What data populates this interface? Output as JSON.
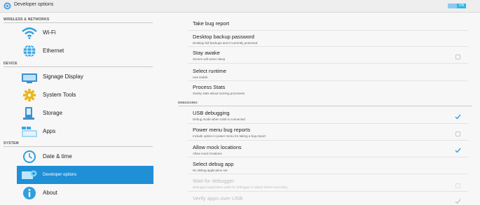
{
  "window": {
    "title": "Developer options",
    "toggle_label": "ON"
  },
  "sidebar": {
    "sections": [
      "WIRELESS & NETWORKS",
      "DEVICE",
      "SYSTEM"
    ],
    "items": [
      {
        "label": "Wi-Fi",
        "icon": "wifi-icon"
      },
      {
        "label": "Ethernet",
        "icon": "ethernet-icon"
      },
      {
        "label": "Signage Display",
        "icon": "display-icon"
      },
      {
        "label": "System Tools",
        "icon": "gear-icon"
      },
      {
        "label": "Storage",
        "icon": "storage-icon"
      },
      {
        "label": "Apps",
        "icon": "apps-icon"
      },
      {
        "label": "Date & time",
        "icon": "clock-icon"
      },
      {
        "label": "Developer options",
        "icon": "developer-icon"
      },
      {
        "label": "About",
        "icon": "info-icon"
      }
    ],
    "active_color": "#1f8fd6"
  },
  "content": {
    "debugging_header": "DEBUGGING",
    "rows": [
      {
        "title": "Take bug report",
        "summary": ""
      },
      {
        "title": "Desktop backup password",
        "summary": "Desktop full backups aren't currently protected"
      },
      {
        "title": "Stay awake",
        "summary": "Screen will never sleep"
      },
      {
        "title": "Select runtime",
        "summary": "Use Dalvik"
      },
      {
        "title": "Process Stats",
        "summary": "Geeky stats about running processes"
      },
      {
        "title": "USB debugging",
        "summary": "Debug mode when USB is connected"
      },
      {
        "title": "Power menu bug reports",
        "summary": "Include option in power menu for taking a bug report"
      },
      {
        "title": "Allow mock locations",
        "summary": "Allow mock locations"
      },
      {
        "title": "Select debug app",
        "summary": "No debug application set"
      },
      {
        "title": "Wait for debugger",
        "summary": "Debugged application waits for debugger to attach before executing"
      },
      {
        "title": "Verify apps over USB",
        "summary": ""
      }
    ],
    "checkbox_states": {
      "stay_awake": false,
      "usb_debugging": true,
      "power_menu_bug_reports": false,
      "allow_mock_locations": true,
      "wait_for_debugger": false,
      "verify_apps_over_usb": true
    }
  }
}
